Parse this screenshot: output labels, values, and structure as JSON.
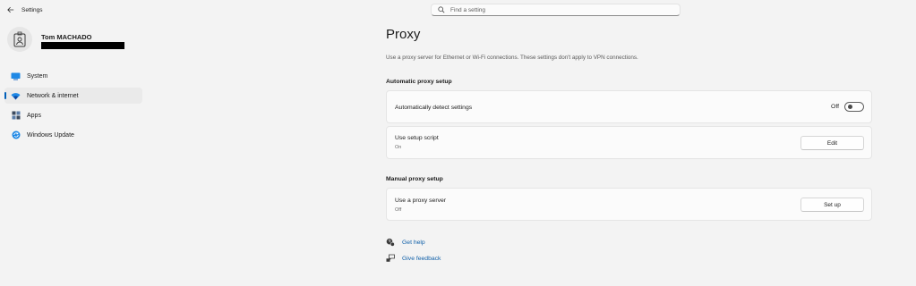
{
  "window": {
    "title": "Settings"
  },
  "search": {
    "placeholder": "Find a setting"
  },
  "profile": {
    "name": "Tom MACHADO"
  },
  "sidebar": {
    "items": [
      {
        "label": "System",
        "icon": "system-icon",
        "active": false
      },
      {
        "label": "Network & internet",
        "icon": "network-icon",
        "active": true
      },
      {
        "label": "Apps",
        "icon": "apps-icon",
        "active": false
      },
      {
        "label": "Windows Update",
        "icon": "windows-update-icon",
        "active": false
      }
    ]
  },
  "main": {
    "title": "Proxy",
    "description": "Use a proxy server for Ethernet or Wi-Fi connections. These settings don't apply to VPN connections.",
    "automatic": {
      "heading": "Automatic proxy setup",
      "detect": {
        "label": "Automatically detect settings",
        "state_text": "Off",
        "on": false
      },
      "script": {
        "label": "Use setup script",
        "sub": "On",
        "button": "Edit"
      }
    },
    "manual": {
      "heading": "Manual proxy setup",
      "proxy": {
        "label": "Use a proxy server",
        "sub": "Off",
        "button": "Set up"
      }
    },
    "links": {
      "help": "Get help",
      "feedback": "Give feedback"
    }
  },
  "colors": {
    "accent": "#005fb8",
    "link": "#0f5fa8",
    "background": "#f3f3f3",
    "card": "#fbfbfb"
  }
}
